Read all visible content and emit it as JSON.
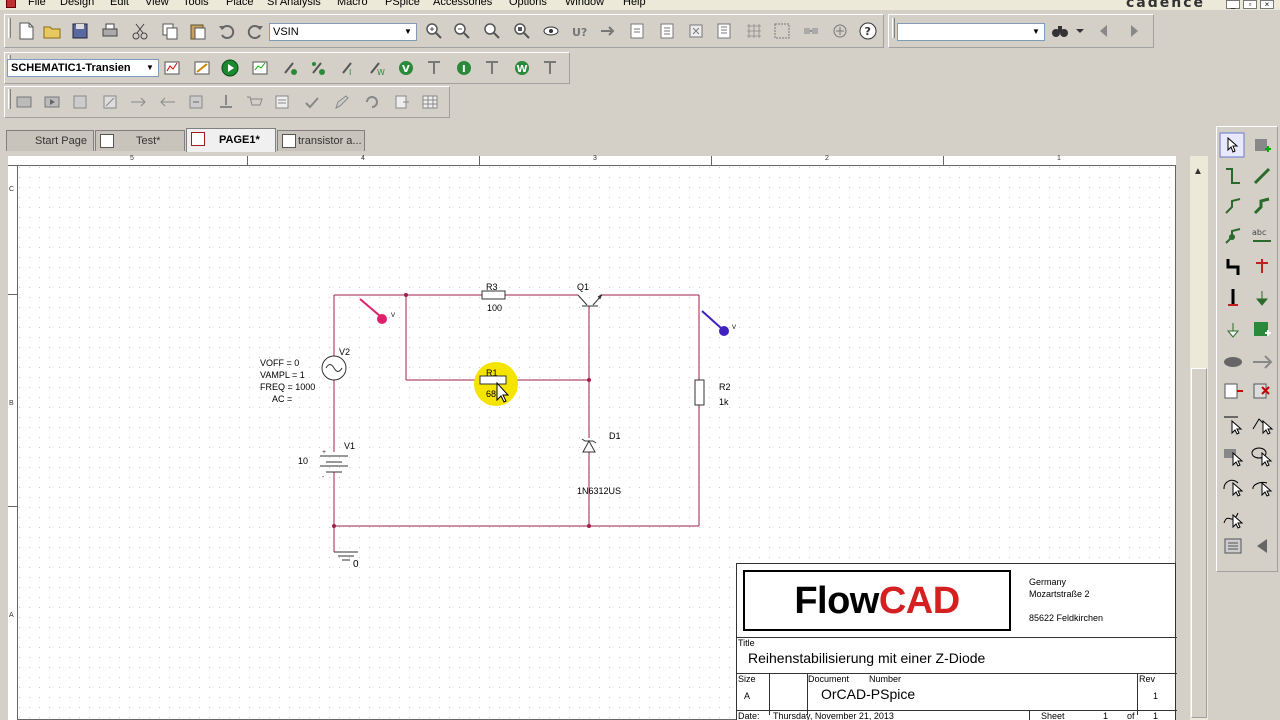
{
  "menu": {
    "items": [
      "File",
      "Design",
      "Edit",
      "View",
      "Tools",
      "Place",
      "SI Analysis",
      "Macro",
      "PSpice",
      "Accessories",
      "Options",
      "Window",
      "Help"
    ],
    "brand": "cadence"
  },
  "toolbar": {
    "part_combo_value": "VSIN",
    "search_combo_value": "",
    "profile_combo_value": "SCHEMATIC1-Transien"
  },
  "tabs": [
    {
      "label": "Start Page"
    },
    {
      "label": "Test*"
    },
    {
      "label": "PAGE1*"
    },
    {
      "label": "transistor a..."
    }
  ],
  "rulers": {
    "top": [
      "5",
      "4",
      "3",
      "2",
      "1"
    ],
    "left": [
      "C",
      "B",
      "A"
    ]
  },
  "schematic": {
    "r3_ref": "R3",
    "r3_val": "100",
    "q1_ref": "Q1",
    "r1_ref": "R1",
    "r1_val": "68",
    "r2_ref": "R2",
    "r2_val": "1k",
    "d1_ref": "D1",
    "d1_val": "1N6312US",
    "v2_ref": "V2",
    "v2_params": [
      "VOFF = 0",
      "VAMPL = 1",
      "FREQ = 1000",
      "AC ="
    ],
    "v1_ref": "V1",
    "v1_val": "10",
    "gnd_label": "0",
    "probe_label": "V",
    "probe_label2": "V",
    "colors": {
      "wire": "#a0204a",
      "probe1": "#e0206a",
      "probe2": "#4020c0",
      "highlight": "#f5e400"
    }
  },
  "titleblock": {
    "logo_flow": "Flow",
    "logo_cad": "CAD",
    "address": [
      "Germany",
      "Mozartstraße 2",
      "85622 Feldkirchen"
    ],
    "title_label": "Title",
    "title_value": "Reihenstabilisierung mit einer Z-Diode",
    "size_label": "Size",
    "size_value": "A",
    "docnum_label": "Document",
    "number_label": "Number",
    "docnum_value": "OrCAD-PSpice",
    "rev_label": "Rev",
    "rev_value": "1",
    "date_label": "Date:",
    "date_value": "Thursday, November 21, 2013",
    "sheet_label": "Sheet",
    "sheet_value": "1",
    "of_label": "of",
    "of_value": "1"
  }
}
